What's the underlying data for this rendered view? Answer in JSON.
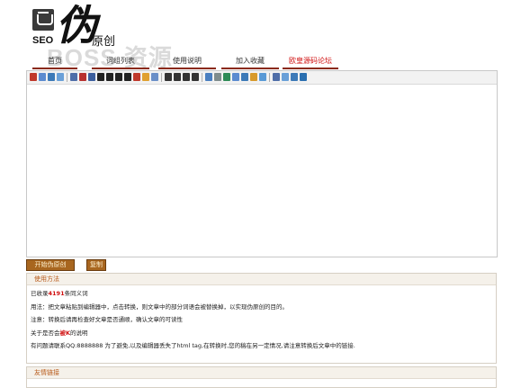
{
  "logo": {
    "seo": "SEO",
    "big": "伪",
    "small": "原创",
    "watermark": "BOSS 资源"
  },
  "nav": [
    {
      "label": "首页",
      "name": "nav-home"
    },
    {
      "label": "词组列表",
      "name": "nav-phrase-list"
    },
    {
      "label": "使用说明",
      "name": "nav-instructions"
    },
    {
      "label": "加入收藏",
      "name": "nav-add-favorite"
    },
    {
      "label": "欧皇源码论坛",
      "name": "nav-forum"
    }
  ],
  "buttons": {
    "generate": "开始伪原创",
    "copy": "复制"
  },
  "usage": {
    "title": "使用方法",
    "phrase_prefix": "已收录",
    "phrase_count": "4191",
    "phrase_suffix": "条同义词",
    "line_usage": "用法：把文章粘贴到编辑器中，点击转换，则文章中的部分词语会被替换掉，以实现伪原创的目的。",
    "line_note": "注意：转换后请再检查好文章是否通顺，确认文章的可读性",
    "about_prefix": "关于是否会",
    "about_highlight": "被K",
    "about_suffix": "的说明",
    "line_contact": "有问题请联系QQ:8888888 为了避免,以及编辑器丢失了html tag,在转换时,您的稿在另一定情况,请注意转换后文章中的链接."
  },
  "links": {
    "title": "友情链接"
  },
  "colors": {
    "nav_border": "#8b2a1a",
    "accent_red": "#d01010",
    "button_bg": "#a8661f",
    "panel_title": "#b85a1a"
  }
}
